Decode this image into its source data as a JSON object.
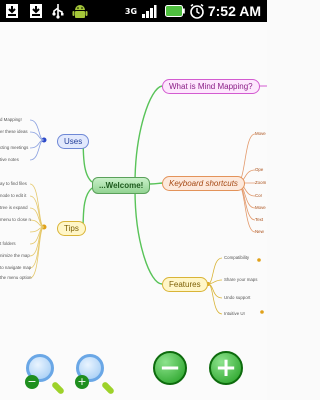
{
  "status_bar": {
    "time": "7:52 AM",
    "icons": [
      "sd-card-download-icon",
      "download-icon",
      "usb-icon",
      "android-icon",
      "3g-signal-icon",
      "signal-strength-icon",
      "battery-icon",
      "alarm-clock-icon"
    ],
    "network_label": "3G"
  },
  "mindmap": {
    "center": "...Welcome!",
    "branches": {
      "what": "What is Mind Mapping?",
      "keyboard": "Keyboard shortcuts",
      "features": "Features",
      "uses": "Uses",
      "tips": "Tips"
    },
    "uses_leaves": [
      "d Mapping!",
      "er these ideas",
      "cting meetings",
      "tive notes"
    ],
    "tips_leaves": [
      "ay to find files",
      "node to edit it",
      "tree is expand",
      "menu to close n",
      "",
      "t folders",
      "nimize the map",
      "to navigate map",
      "the menu option"
    ],
    "keyboard_leaves": [
      "Move",
      "Ope",
      "Zoom",
      "Cor",
      "Move",
      "Text",
      "New"
    ],
    "features_leaves": [
      "Compatibility",
      "Share your maps",
      "Undo support",
      "Intuitive UI"
    ]
  },
  "controls": {
    "zoom_out": "−",
    "zoom_in": "+",
    "minus": "−",
    "plus": "+"
  }
}
